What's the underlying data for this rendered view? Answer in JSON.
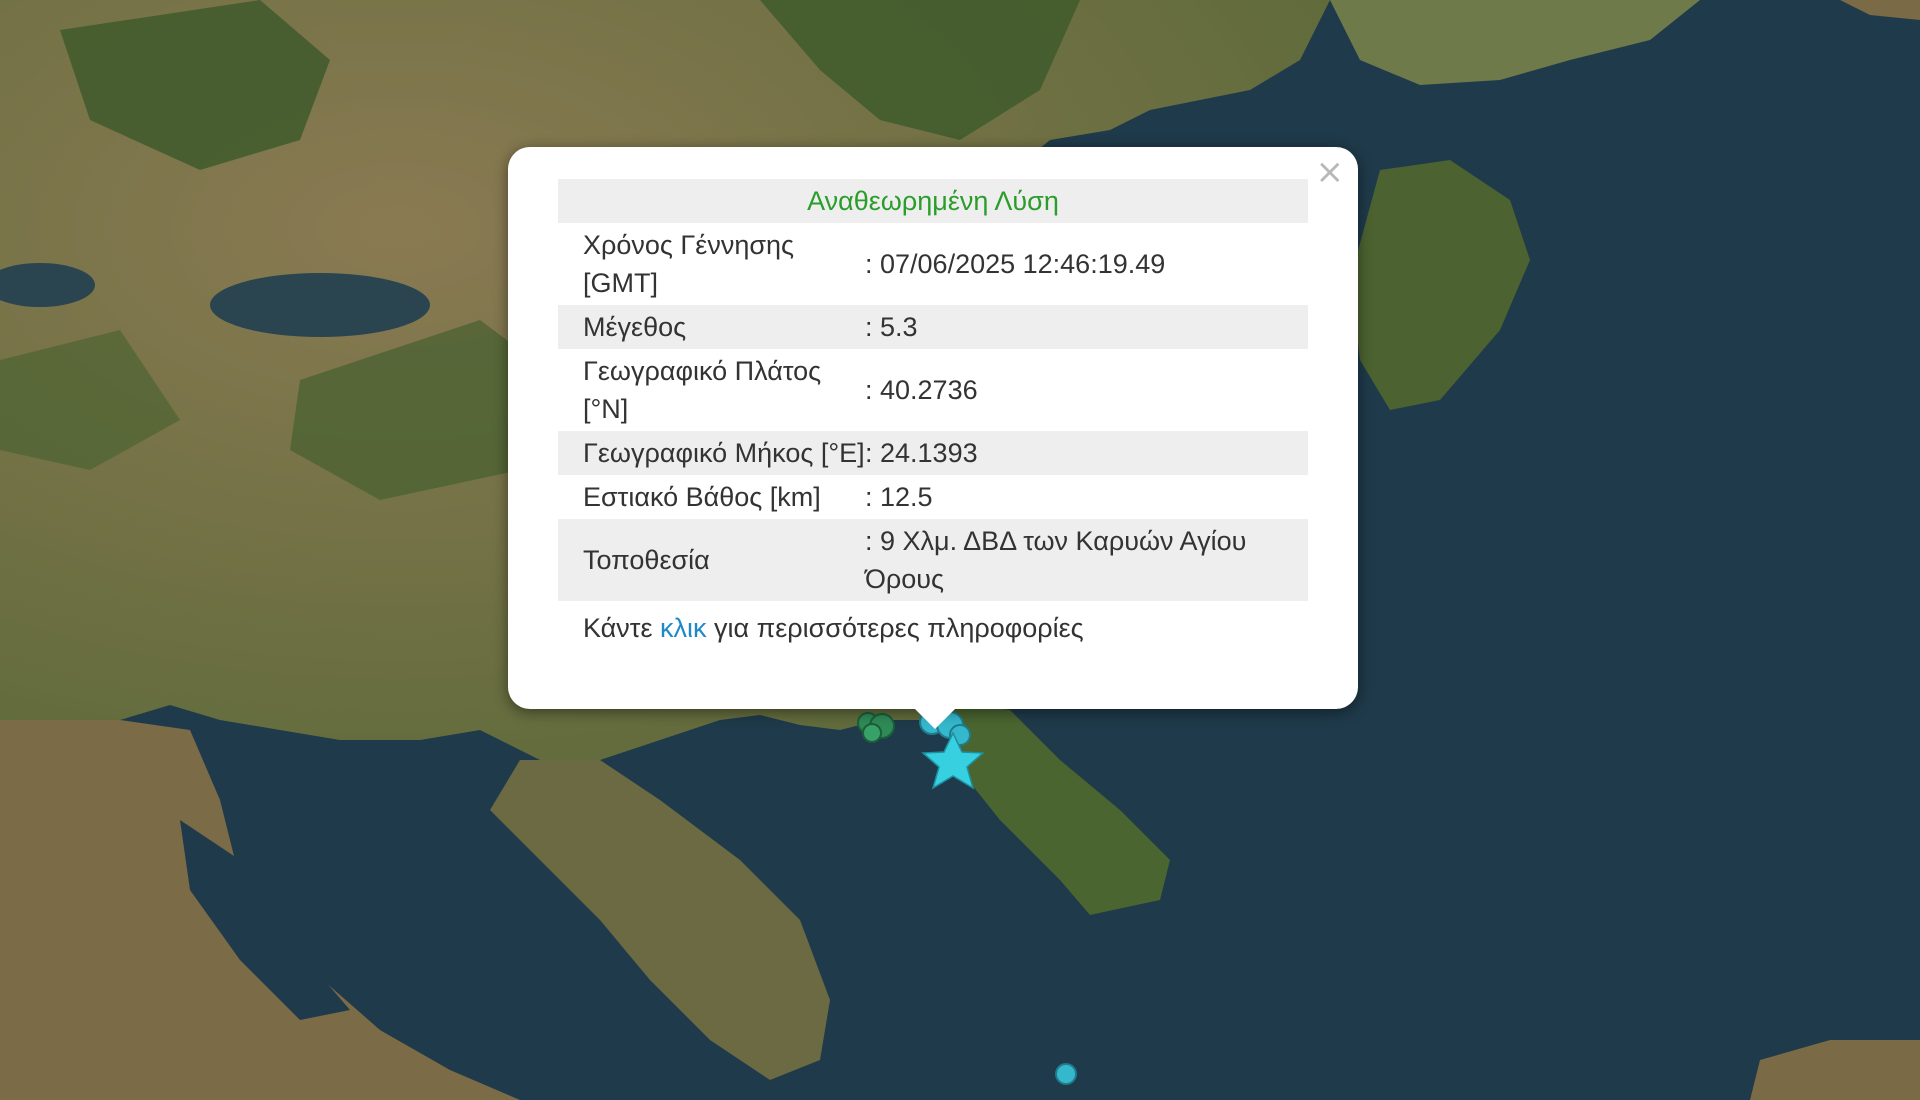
{
  "popup": {
    "title": "Αναθεωρημένη Λύση",
    "close_symbol": "×",
    "rows": [
      {
        "label": "Χρόνος Γέννησης [GMT]",
        "value": ": 07/06/2025 12:46:19.49"
      },
      {
        "label": "Μέγεθος",
        "value": ": 5.3"
      },
      {
        "label": "Γεωγραφικό Πλάτος [°N]",
        "value": ": 40.2736"
      },
      {
        "label": "Γεωγραφικό Μήκος [°E]",
        "value": ": 24.1393"
      },
      {
        "label": "Εστιακό Βάθος [km]",
        "value": ": 12.5"
      },
      {
        "label": "Τοποθεσία",
        "value": ": 9 Χλμ. ΔΒΔ των Καρυών Αγίου Όρους"
      }
    ],
    "more_prefix": "Κάντε ",
    "more_link": "κλικ",
    "more_suffix": " για περισσότερες πληροφορίες"
  },
  "map": {
    "base": "satellite imagery",
    "sea_color": "#1f3a4a",
    "land_color": "#7a6a45",
    "forest_color": "#3f5a2c",
    "epicenter_icon": "star-icon",
    "epicenter_color": "#36d0e0",
    "event_icon": "circle-icon",
    "event_colors": [
      "#2e8b57",
      "#36b8cc"
    ]
  }
}
